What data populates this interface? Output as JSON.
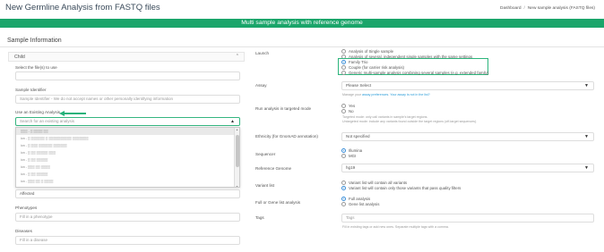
{
  "header": {
    "title": "New Germline Analysis from FASTQ files",
    "breadcrumb": [
      "Dashboard",
      "New sample analysis (FASTQ files)"
    ]
  },
  "banner": {
    "text": "Multi sample analysis with reference genome",
    "color": "#1aa56a"
  },
  "sample_information": {
    "title": "Sample Information",
    "panel": {
      "title": "Child",
      "collapse_icon": "chevron-up-icon"
    },
    "files": {
      "label": "Select the file(s) to use"
    },
    "identifier": {
      "label": "Sample Identifier",
      "placeholder": "Sample Identifier - We do not accept names or other personally identifying information"
    },
    "existing_analysis": {
      "label": "Use an Existing Analysis",
      "placeholder": "Search for an existing analysis",
      "options": [
        "▒▒▒ - ▒ ▒▒▒▒ ▒▒",
        "ion - ▒ ▒▒▒▒▒▒ ▒ ▒▒▒▒▒▒▒▒▒▒ ▒▒▒▒▒▒▒",
        "ion - ▒ ▒▒▒ ▒▒▒▒▒▒ ▒▒▒▒▒▒",
        "ion - ▒ ▒▒ ▒▒▒▒▒ ▒▒▒",
        "ion - ▒ ▒▒ ▒▒▒▒▒",
        "ion - ▒▒▒ ▒▒ ▒▒▒▒",
        "ion - ▒ ▒▒ ▒▒▒▒▒",
        "ion - ▒▒▒ ▒▒ ▒ ▒▒▒▒"
      ],
      "highlighted_index": 0
    },
    "affected": {
      "value": "Affected"
    },
    "phenotypes": {
      "label": "Phenotypes",
      "placeholder": "Fill in a phenotype"
    },
    "diseases": {
      "label": "Diseases",
      "placeholder": "Fill in a disease"
    }
  },
  "launch": {
    "label": "Launch",
    "options": [
      "Analysis of Single sample",
      "Analysis of several, independent single samples with the same settings",
      "Family Trio",
      "Couple (for carrier risk analysis)",
      "Generic multi-sample analysis combining several samples (e.g. extended family)"
    ],
    "selected_index": 2,
    "highlight_color": "#2db57c"
  },
  "assay": {
    "label": "Assay",
    "value": "Please Select",
    "hint_prefix": "Manage your",
    "hint_link": "assay preferences",
    "hint_suffix": "Your assay is not in the list?"
  },
  "targeted_mode": {
    "label": "Run analysis in targeted mode",
    "options": [
      "Yes",
      "No"
    ],
    "selected_index": -1,
    "hint_line1": "Targeted mode: only call variants in sample's target regions.",
    "hint_line2": "Untargeted mode: include any variants found outside the target regions (off-target sequences)."
  },
  "ethnicity": {
    "label": "Ethnicity (for GnomAD annotation)",
    "value": "Not specified"
  },
  "sequencer": {
    "label": "Sequencer",
    "options": [
      "Illumina",
      "MGI"
    ],
    "selected_index": 0
  },
  "reference_genome": {
    "label": "Reference Genome",
    "value": "hg19"
  },
  "variant_list": {
    "label": "Variant list",
    "options": [
      "Variant list will contain all variants",
      "Variant list will contain only those variants that pass quality filters"
    ],
    "selected_index": 1
  },
  "analysis_scope": {
    "label": "Full or Gene list analysis",
    "options": [
      "Full analysis",
      "Gene list analysis"
    ],
    "selected_index": 0
  },
  "tags": {
    "label": "Tags",
    "placeholder": "Tags",
    "hint": "Fill in existing tags or add new ones. Separate multiple tags with a comma."
  }
}
